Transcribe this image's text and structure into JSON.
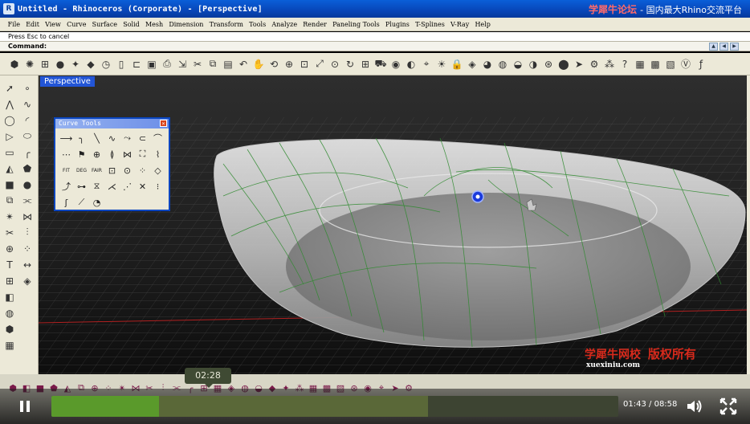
{
  "window": {
    "title": "Untitled - Rhinoceros (Corporate) - [Perspective]",
    "watermark_top_brand": "学犀牛论坛",
    "watermark_top_text": "国内最大Rhino交流平台"
  },
  "menu": [
    "File",
    "Edit",
    "View",
    "Curve",
    "Surface",
    "Solid",
    "Mesh",
    "Dimension",
    "Transform",
    "Tools",
    "Analyze",
    "Render",
    "Paneling Tools",
    "Plugins",
    "T-Splines",
    "V-Ray",
    "Help"
  ],
  "command": {
    "history": "Press Esc to cancel",
    "prompt": "Command:"
  },
  "toolbar_icons": [
    "box-icon",
    "sun-icon",
    "grid-icon",
    "sphere-icon",
    "star-icon",
    "diamond-icon",
    "clock-icon",
    "new-icon",
    "open-icon",
    "save-icon",
    "print-icon",
    "import-icon",
    "cut-icon",
    "copy-icon",
    "paste-icon",
    "undo-icon",
    "pan-hand-icon",
    "rotate-icon",
    "zoom-icon",
    "zoom-window-icon",
    "zoom-extents-icon",
    "zoom-selected-icon",
    "rotate-view-icon",
    "grid-toggle-icon",
    "car-icon",
    "eye-icon",
    "visibility-icon",
    "snap-icon",
    "light-icon",
    "lock-icon",
    "layer-icon",
    "color-icon",
    "render-icon",
    "material-icon",
    "environment-icon",
    "wire-icon",
    "sphere-render-icon",
    "pointer-icon",
    "gear-icon",
    "cluster-icon",
    "help-icon",
    "panel-icon",
    "scene-icon",
    "map-icon",
    "vray-icon",
    "fd-icon"
  ],
  "left_tools": [
    "select-arrow-icon",
    "point-icon",
    "polyline-icon",
    "curve-icon",
    "circle-icon",
    "arc-icon",
    "triangle-icon",
    "ellipse-icon",
    "rectangle-icon",
    "fillet-icon",
    "surface-icon",
    "patch-icon",
    "solid-box-icon",
    "solid-sphere-icon",
    "boolean-icon",
    "offset-icon",
    "explode-icon",
    "join-icon",
    "trim-icon",
    "split-icon",
    "gumball-icon",
    "array-icon",
    "text-icon",
    "dimension-icon",
    "group-icon",
    "layer-icon",
    "cube-icon",
    "blank-icon",
    "render-icon",
    "blank-icon",
    "box-icon",
    "blank-icon",
    "mesh-icon",
    "blank-icon"
  ],
  "viewport": {
    "label": "Perspective"
  },
  "curve_tools": {
    "title": "Curve Tools",
    "fit_label": "FIT",
    "deg_label": "DEG",
    "fair_label": "FAIR"
  },
  "watermark": {
    "brand": "学犀牛网校",
    "url": "xuexiniu.com",
    "rights": "版权所有"
  },
  "player": {
    "current_time": "01:43",
    "total_time": "08:58",
    "separator": "/",
    "hover_time": "02:28",
    "progress": 0.1905,
    "buffered": 0.665
  }
}
